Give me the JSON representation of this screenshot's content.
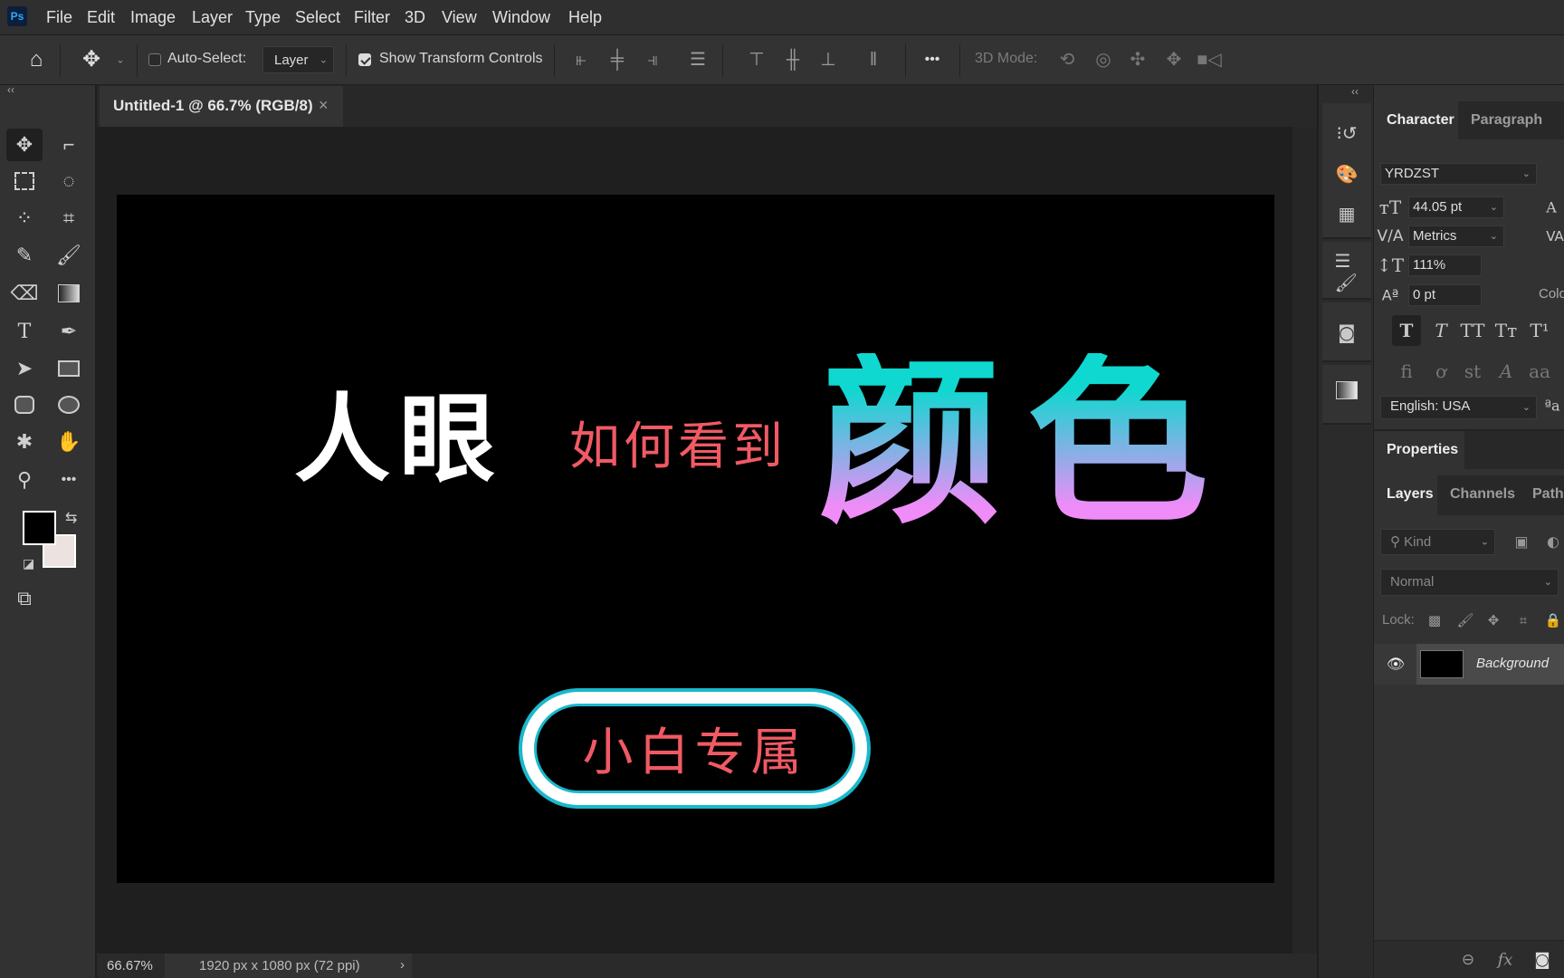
{
  "app": {
    "logo": "Ps"
  },
  "menu": [
    "File",
    "Edit",
    "Image",
    "Layer",
    "Type",
    "Select",
    "Filter",
    "3D",
    "View",
    "Window",
    "Help"
  ],
  "options": {
    "auto_select_label": "Auto-Select:",
    "auto_select_checked": false,
    "layer_dropdown": "Layer",
    "show_transform_label": "Show Transform Controls",
    "show_transform_checked": true,
    "more": "•••",
    "mode_3d_label": "3D Mode:"
  },
  "document_tab": {
    "title": "Untitled-1 @ 66.7% (RGB/8)",
    "close": "×"
  },
  "canvas": {
    "line1": "人眼",
    "line2": "如何看到",
    "line3": "颜色",
    "badge": "小白专属",
    "colors": {
      "white_text": "#ffffff",
      "red_text": "#f05a64",
      "gradient_top": "#0fd8d0",
      "gradient_bottom": "#f08cf8",
      "pill_outline": "#1ab8cc",
      "pill_fill": "#ffffff"
    }
  },
  "status": {
    "zoom": "66.67%",
    "doc_info": "1920 px x 1080 px (72 ppi)",
    "arrow": "›"
  },
  "toolbar": {
    "foreground_color": "#000000",
    "background_color": "#ece2e0"
  },
  "character": {
    "tabs": [
      "Character",
      "Paragraph"
    ],
    "font": "YRDZST",
    "size": "44.05 pt",
    "kerning": "Metrics",
    "vertical_scale": "111%",
    "baseline_shift": "0 pt",
    "color_label": "Colo",
    "language": "English: USA",
    "style_buttons": [
      "T",
      "T",
      "TT",
      "Tт",
      "T¹"
    ],
    "opentype_buttons": [
      "ﬁ",
      "ơ",
      "st",
      "A",
      "aa"
    ],
    "aa_label": "ªa"
  },
  "properties": {
    "tab": "Properties"
  },
  "layers": {
    "tabs": [
      "Layers",
      "Channels",
      "Paths"
    ],
    "filter": "Kind",
    "blend_mode": "Normal",
    "lock_label": "Lock:",
    "items": [
      {
        "name": "Background",
        "visible": true,
        "thumb_color": "#000000"
      }
    ]
  },
  "collapse": "‹‹"
}
